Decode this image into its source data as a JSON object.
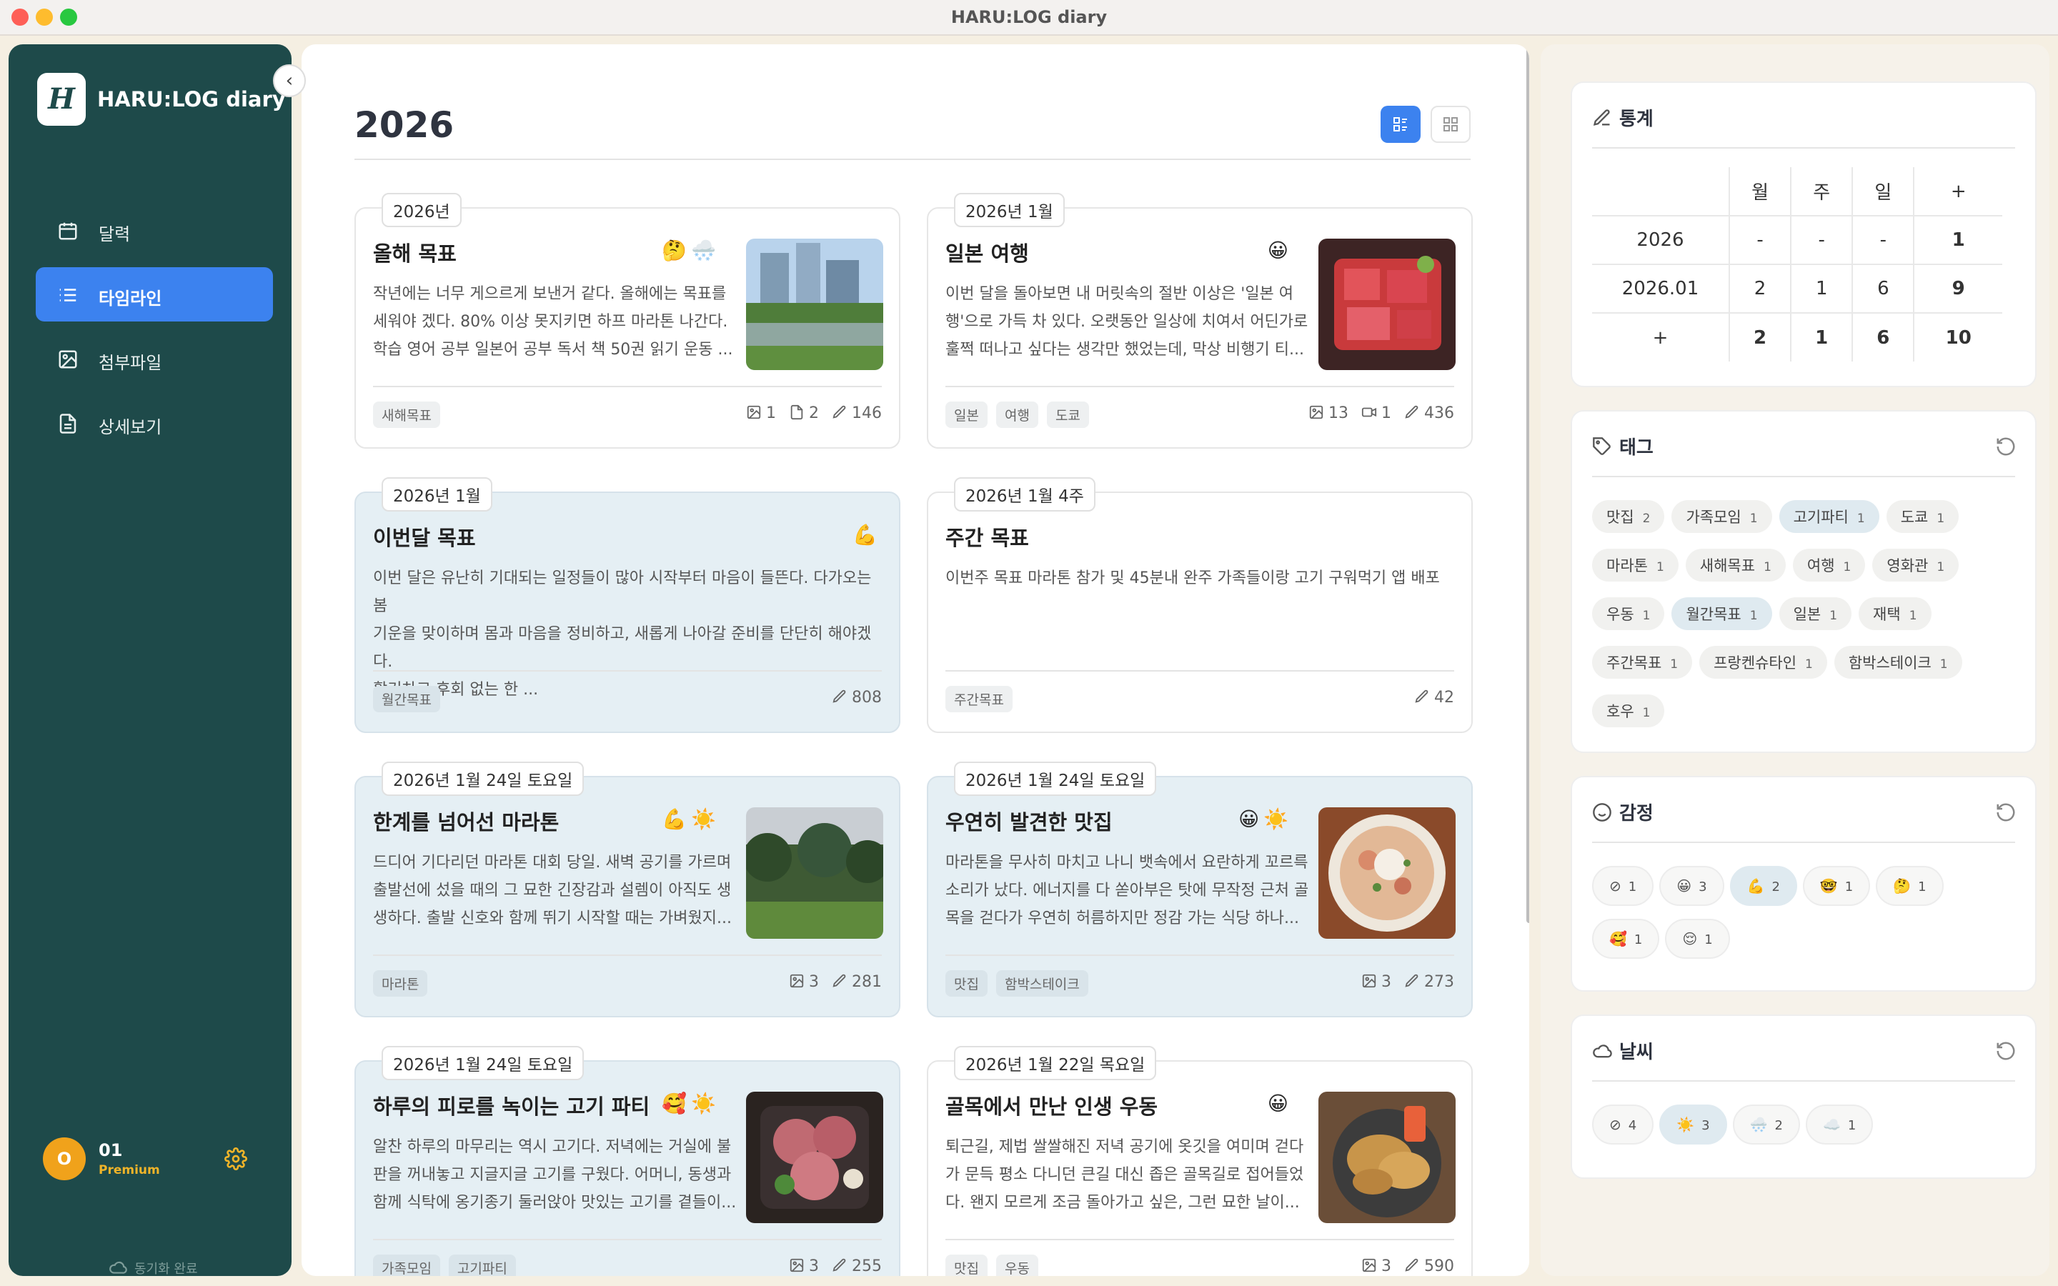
{
  "window": {
    "title": "HARU:LOG diary"
  },
  "sidebar": {
    "logo_mark": "H",
    "app_name": "HARU:LOG diary",
    "items": [
      {
        "label": "달력",
        "icon": "calendar-icon"
      },
      {
        "label": "타임라인",
        "icon": "list-icon",
        "active": true
      },
      {
        "label": "첨부파일",
        "icon": "image-icon"
      },
      {
        "label": "상세보기",
        "icon": "document-icon"
      }
    ],
    "user": {
      "avatar": "O",
      "name": "01",
      "tier": "Premium"
    },
    "sync_status": "동기화 완료"
  },
  "main": {
    "heading": "2026",
    "view_modes": [
      "list",
      "grid"
    ],
    "active_view": "list",
    "cards": [
      {
        "period": "2026년",
        "title": "올해 목표",
        "emojis": "🤔🌨️",
        "lines": [
          "작년에는 너무 게으르게 보낸거 같다. 올해에는 목표를",
          "세워야 겠다. 80% 이상 못지키면 하프 마라톤 나간다.",
          "학습 영어 공부 일본어 공부 독서 책 50권 읽기 운동 ..."
        ],
        "tags": [
          "새해목표"
        ],
        "images": "1",
        "docs": "2",
        "chars": "146",
        "highlight": false,
        "photo": "garden"
      },
      {
        "period": "2026년 1월",
        "title": "일본 여행",
        "emojis": "😀",
        "lines": [
          "이번 달을 돌아보면 내 머릿속의 절반 이상은 '일본 여",
          "행'으로 가득 차 있다. 오랫동안 일상에 치여서 어딘가로",
          "훌쩍 떠나고 싶다는 생각만 했었는데, 막상 비행기 티..."
        ],
        "tags": [
          "일본",
          "여행",
          "도쿄"
        ],
        "images": "13",
        "videos": "1",
        "chars": "436",
        "highlight": false,
        "photo": "tuna"
      },
      {
        "period": "2026년 1월",
        "title": "이번달 목표",
        "emojis": "💪",
        "lines": [
          "이번 달은 유난히 기대되는 일정들이 많아 시작부터 마음이 들뜬다. 다가오는 봄",
          "기운을 맞이하며 몸과 마음을 정비하고, 새롭게 나아갈 준비를 단단히 해야겠다.",
          "활기차고 후회 없는 한 ..."
        ],
        "tags": [
          "월간목표"
        ],
        "chars": "808",
        "highlight": true,
        "photo": ""
      },
      {
        "period": "2026년 1월 4주",
        "title": "주간 목표",
        "emojis": "",
        "lines": [
          "이번주 목표 마라톤 참가 및 45분내 완주 가족들이랑 고기 구워먹기 앱 배포"
        ],
        "tags": [
          "주간목표"
        ],
        "chars": "42",
        "highlight": false,
        "photo": ""
      },
      {
        "period": "2026년 1월 24일 토요일",
        "title": "한계를 넘어선 마라톤",
        "emojis": "💪☀️",
        "lines": [
          "드디어 기다리던 마라톤 대회 당일. 새벽 공기를 가르며",
          "출발선에 섰을 때의 그 묘한 긴장감과 설렘이 아직도 생",
          "생하다. 출발 신호와 함께 뛰기 시작할 때는 가벼웠지..."
        ],
        "tags": [
          "마라톤"
        ],
        "images": "3",
        "chars": "281",
        "highlight": true,
        "photo": "park"
      },
      {
        "period": "2026년 1월 24일 토요일",
        "title": "우연히 발견한 맛집",
        "emojis": "😀☀️",
        "lines": [
          "마라톤을 무사히 마치고 나니 뱃속에서 요란하게 꼬르륵",
          "소리가 났다. 에너지를 다 쏟아부은 탓에 무작정 근처 골",
          "목을 걷다가 우연히 허름하지만 정감 가는 식당 하나..."
        ],
        "tags": [
          "맛집",
          "함박스테이크"
        ],
        "images": "3",
        "chars": "273",
        "highlight": true,
        "photo": "soup"
      },
      {
        "period": "2026년 1월 24일 토요일",
        "title": "하루의 피로를 녹이는 고기 파티",
        "emojis": "🥰☀️",
        "lines": [
          "알찬 하루의 마무리는 역시 고기다. 저녁에는 거실에 불",
          "판을 꺼내놓고 지글지글 고기를 구웠다. 어머니, 동생과",
          "함께 식탁에 옹기종기 둘러앉아 맛있는 고기를 곁들이..."
        ],
        "tags": [
          "가족모임",
          "고기파티"
        ],
        "images": "3",
        "chars": "255",
        "highlight": true,
        "photo": "meat"
      },
      {
        "period": "2026년 1월 22일 목요일",
        "title": "골목에서 만난 인생 우동",
        "emojis": "😀",
        "lines": [
          "퇴근길, 제법 쌀쌀해진 저녁 공기에 옷깃을 여미며 걷다",
          "가 문득 평소 다니던 큰길 대신 좁은 골목길로 접어들었",
          "다. 왠지 모르게 조금 돌아가고 싶은, 그런 묘한 날이..."
        ],
        "tags": [
          "맛집",
          "우동"
        ],
        "images": "3",
        "chars": "590",
        "highlight": false,
        "photo": "tempura"
      }
    ]
  },
  "stats": {
    "title": "통계",
    "columns": [
      "월",
      "주",
      "일",
      "+"
    ],
    "rows": [
      {
        "label": "2026",
        "cells": [
          "-",
          "-",
          "-",
          "1"
        ]
      },
      {
        "label": "2026.01",
        "cells": [
          "2",
          "1",
          "6",
          "9"
        ]
      },
      {
        "label": "+",
        "cells": [
          "2",
          "1",
          "6",
          "10"
        ]
      }
    ]
  },
  "tags": {
    "title": "태그",
    "items": [
      {
        "name": "맛집",
        "count": "2"
      },
      {
        "name": "가족모임",
        "count": "1"
      },
      {
        "name": "고기파티",
        "count": "1",
        "selected": true
      },
      {
        "name": "도쿄",
        "count": "1"
      },
      {
        "name": "마라톤",
        "count": "1"
      },
      {
        "name": "새해목표",
        "count": "1"
      },
      {
        "name": "여행",
        "count": "1"
      },
      {
        "name": "영화관",
        "count": "1"
      },
      {
        "name": "우동",
        "count": "1"
      },
      {
        "name": "월간목표",
        "count": "1",
        "selected": true
      },
      {
        "name": "일본",
        "count": "1"
      },
      {
        "name": "재택",
        "count": "1"
      },
      {
        "name": "주간목표",
        "count": "1"
      },
      {
        "name": "프랑켄슈타인",
        "count": "1"
      },
      {
        "name": "함박스테이크",
        "count": "1"
      },
      {
        "name": "호우",
        "count": "1"
      }
    ]
  },
  "moods": {
    "title": "감정",
    "items": [
      {
        "emoji": "⊘",
        "count": "1"
      },
      {
        "emoji": "😀",
        "count": "3"
      },
      {
        "emoji": "💪",
        "count": "2",
        "selected": true
      },
      {
        "emoji": "🤓",
        "count": "1"
      },
      {
        "emoji": "🤔",
        "count": "1"
      },
      {
        "emoji": "🥰",
        "count": "1"
      },
      {
        "emoji": "😌",
        "count": "1"
      }
    ]
  },
  "weather": {
    "title": "날씨",
    "items": [
      {
        "emoji": "⊘",
        "count": "4"
      },
      {
        "emoji": "☀️",
        "count": "3",
        "selected": true
      },
      {
        "emoji": "🌨️",
        "count": "2"
      },
      {
        "emoji": "☁️",
        "count": "1"
      }
    ]
  },
  "colors": {
    "sidebar": "#1e4a4a",
    "accent": "#3c82ef",
    "highlight_card": "#e5eff4",
    "premium": "#f0a21b"
  }
}
